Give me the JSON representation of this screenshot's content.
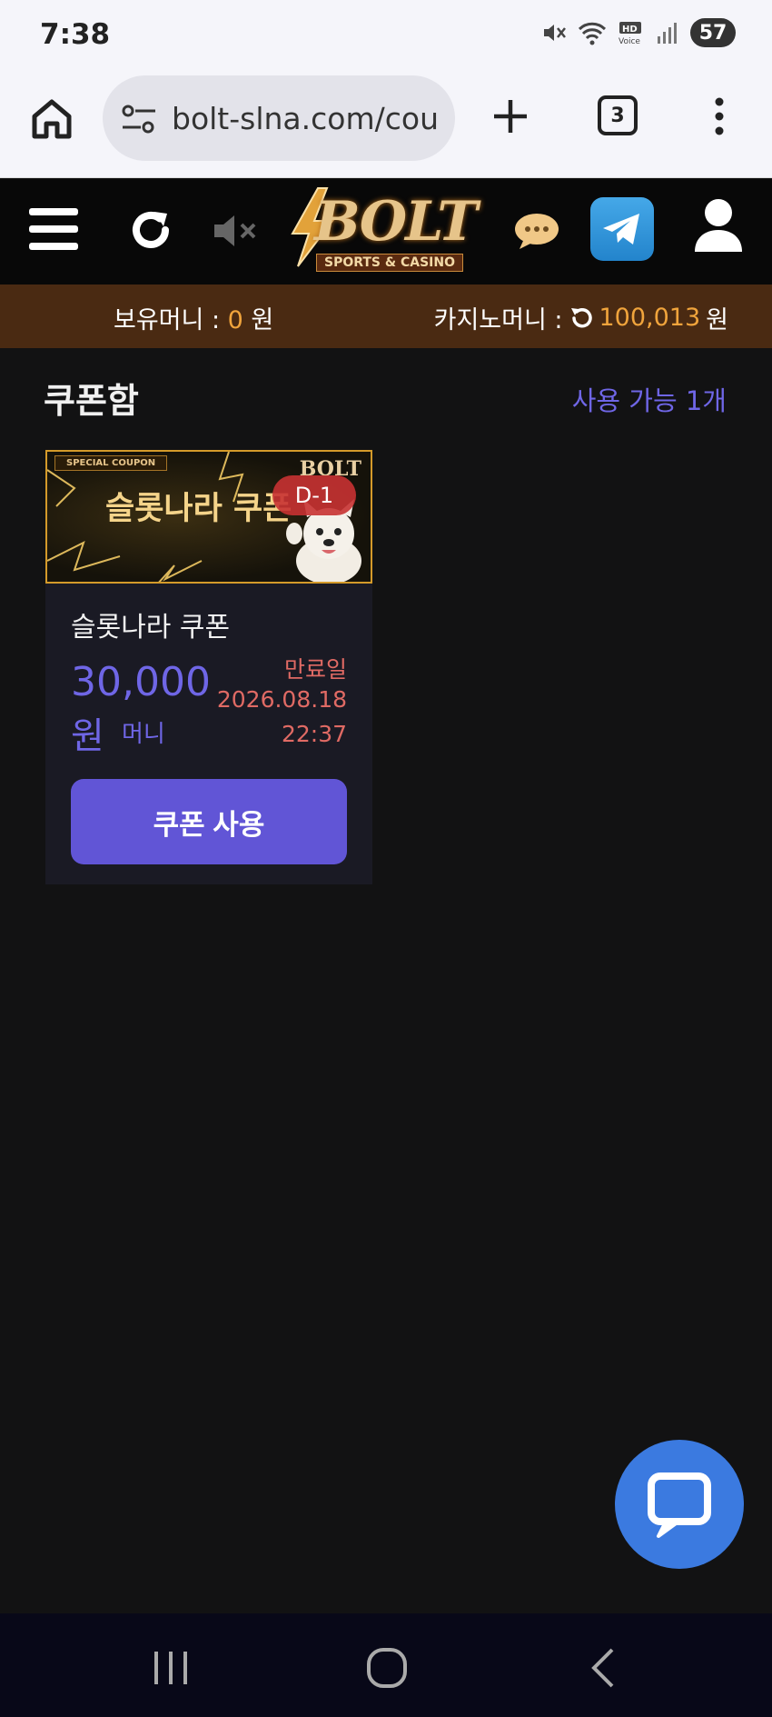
{
  "status_bar": {
    "time": "7:38",
    "battery": "57",
    "icons": [
      "mute-icon",
      "wifi-icon",
      "hd-voice-icon",
      "signal-icon",
      "battery-icon"
    ]
  },
  "browser": {
    "url": "bolt-slna.com/cou",
    "tab_count": "3",
    "icons": [
      "home-icon",
      "site-settings-icon",
      "plus-icon",
      "tabs-icon",
      "more-vert-icon"
    ]
  },
  "site_header": {
    "logo_text": "BOLT",
    "logo_subtitle": "SPORTS & CASINO",
    "icons": [
      "menu-icon",
      "refresh-icon",
      "sound-off-icon",
      "chat-icon",
      "telegram-icon",
      "user-icon"
    ]
  },
  "money_bar": {
    "holding_label": "보유머니 : ",
    "holding_value": "0",
    "holding_unit": " 원",
    "casino_label": "카지노머니 : ",
    "casino_value": "100,013",
    "casino_unit": "원"
  },
  "coupon_box": {
    "title": "쿠폰함",
    "available_text": "사용 가능 1개",
    "coupons": [
      {
        "banner_tag": "SPECIAL COUPON",
        "banner_title": "슬롯나라 쿠폰",
        "banner_brand": "BOLT",
        "dday": "D-1",
        "name": "슬롯나라 쿠폰",
        "amount": "30,000",
        "amount_unit": "원",
        "money_type": "머니",
        "expiry_label": "만료일",
        "expiry_date": "2026.08.18",
        "expiry_time": "22:37",
        "use_button": "쿠폰 사용"
      }
    ]
  },
  "colors": {
    "accent": "#6155d6",
    "gold": "#f0a43c",
    "expiry": "#e06a64",
    "background": "#121213",
    "money_bar": "#4a2a12"
  },
  "system_nav": {
    "icons": [
      "recents-icon",
      "home-circle-icon",
      "back-icon"
    ]
  }
}
